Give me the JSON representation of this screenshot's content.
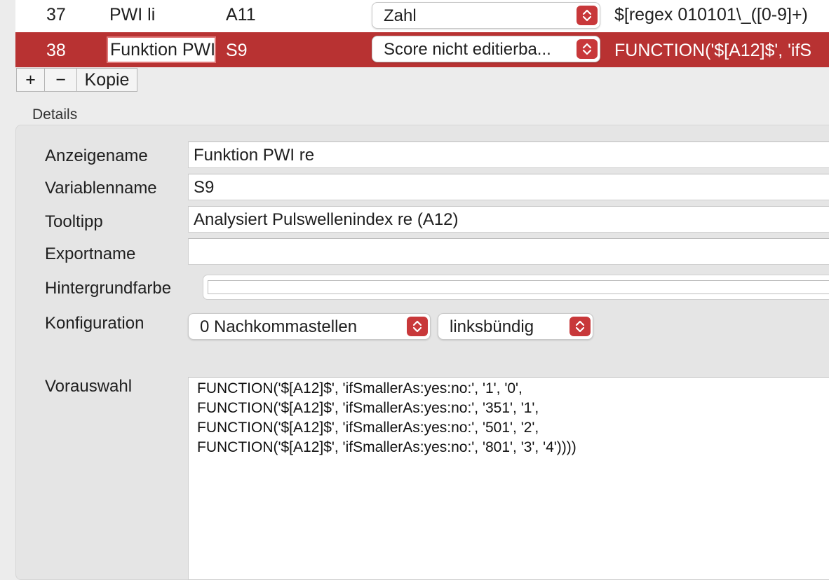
{
  "table": {
    "rows": [
      {
        "num": "37",
        "name": "PWI li",
        "var": "A11",
        "type": "Zahl",
        "expr": "$[regex 010101\\_([0-9]+)",
        "selected": false
      },
      {
        "num": "38",
        "name": "Funktion PWI re",
        "var": "S9",
        "type": "Score nicht editierba...",
        "expr": "FUNCTION('$[A12]$', 'ifS",
        "selected": true
      }
    ]
  },
  "toolbar": {
    "add_label": "+",
    "remove_label": "−",
    "copy_label": "Kopie"
  },
  "details": {
    "title": "Details",
    "labels": {
      "display_name": "Anzeigename",
      "variable_name": "Variablenname",
      "tooltip": "Tooltipp",
      "export_name": "Exportname",
      "background_color": "Hintergrundfarbe",
      "configuration": "Konfiguration",
      "preselection": "Vorauswahl"
    },
    "values": {
      "display_name": "Funktion PWI re",
      "variable_name": "S9",
      "tooltip": "Analysiert Pulswellenindex re (A12)",
      "export_name": "",
      "background_color": "#ffffff",
      "decimals": "0 Nachkommastellen",
      "alignment": "linksbündig",
      "preselection_lines": [
        "FUNCTION('$[A12]$', 'ifSmallerAs:yes:no:', '1', '0',",
        "FUNCTION('$[A12]$', 'ifSmallerAs:yes:no:', '351', '1',",
        "FUNCTION('$[A12]$', 'ifSmallerAs:yes:no:', '501', '2',",
        "FUNCTION('$[A12]$', 'ifSmallerAs:yes:no:', '801', '3', '4'))))"
      ]
    }
  },
  "colors": {
    "selection": "#b83232",
    "stepper": "#c8383a"
  }
}
